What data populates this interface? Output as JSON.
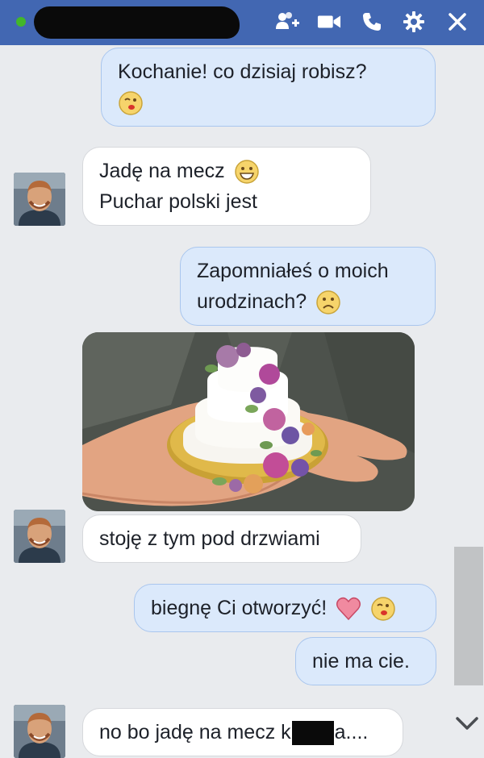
{
  "header": {
    "icons": [
      "add-people-icon",
      "video-call-icon",
      "phone-call-icon",
      "gear-icon",
      "close-icon"
    ],
    "colors": {
      "bar": "#4267b2",
      "online": "#42b72a"
    }
  },
  "messages": [
    {
      "side": "out",
      "lines": [
        "Kochanie! co dzisiaj robisz?"
      ],
      "emoji": "kiss-emoji"
    },
    {
      "side": "in",
      "line1": "Jadę na mecz",
      "line2": "Puchar polski jest",
      "emoji": "grin-emoji"
    },
    {
      "side": "out",
      "line1": "Zapomniałeś o moich",
      "line2": "urodzinach?",
      "emoji": "frown-emoji"
    },
    {
      "side": "in",
      "type": "photo",
      "photo": "cake-in-hand-photo"
    },
    {
      "side": "in",
      "text": "stoję z tym pod drzwiami"
    },
    {
      "side": "out",
      "text": "biegnę Ci otworzyć!",
      "emoji": [
        "heart-emoji",
        "kiss-emoji"
      ]
    },
    {
      "side": "out",
      "text": "nie ma cie."
    },
    {
      "side": "in",
      "text_before": "no bo jadę na mecz k",
      "text_after": "a...."
    }
  ]
}
